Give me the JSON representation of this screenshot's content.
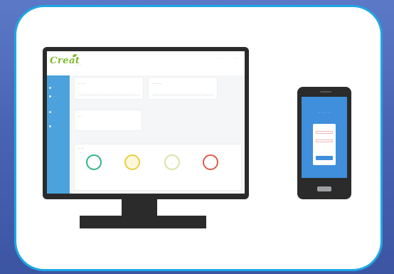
{
  "monitor": {
    "logo": "Creat",
    "top_links": [
      "· ·· ·",
      "·· ·· ·"
    ],
    "breadcrumb": "··· ···",
    "sidebar_items": [
      "··· ···· ··",
      "···· ··· ·",
      "·· ····· ·",
      "··· ··· ··"
    ],
    "panels": [
      {
        "title": "··· ··· ··",
        "cells": [
          "·· ·· ·",
          "·· ··",
          "·· ·· ·",
          "·· ·"
        ]
      },
      {
        "title": "·· ··· ·· ··",
        "cells": [
          "· ·· ·· ·",
          "·· ·",
          "·· ··"
        ]
      },
      {
        "title": "··· ·",
        "cells": [
          "·· ·· ·",
          "·· ·",
          "··"
        ]
      }
    ],
    "gauges_title": "··· ···",
    "gauges": [
      {
        "value": "··",
        "label": "·· ··",
        "color": "#33b38a"
      },
      {
        "value": "··",
        "label": "·· ··",
        "color": "#e8cf3a"
      },
      {
        "value": "··",
        "label": "·· ··",
        "color": "#c9d75a"
      },
      {
        "value": "··",
        "label": "·· ··",
        "color": "#e35a4a"
      }
    ]
  },
  "phone": {
    "title": "··· ···· ·· ····",
    "fields": [
      "",
      ""
    ],
    "button": ""
  },
  "colors": {
    "background": "#4a64b4",
    "card_border": "#1ea7e3",
    "sidebar": "#4ba2dd",
    "logo_green": "#7cbb2a",
    "phone_screen": "#3f8fdc"
  }
}
